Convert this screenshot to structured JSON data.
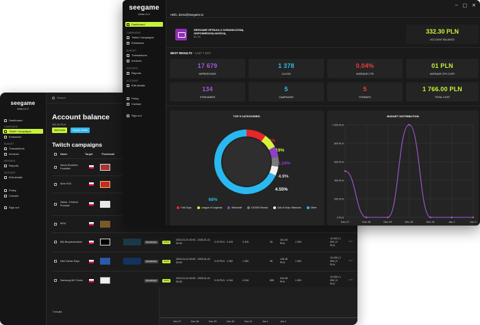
{
  "back": {
    "logo": "seegame",
    "version": "beta v1.0",
    "nav": {
      "sec_campaigns": "CAMPAIGNS",
      "sec_budget": "BUDGET",
      "sec_reports": "REPORTS",
      "sec_account": "ACCOUNT",
      "dashboard": "Dashboard",
      "twitch_campaigns": "Twitch Campaigns",
      "emissions": "Emissions",
      "transactions": "Transactions",
      "invoices": "Invoices",
      "reports": "Reports",
      "edit_details": "Edit details",
      "policy": "Policy",
      "contact": "Contact",
      "sign_out": "Sign out"
    },
    "search_placeholder": "Search",
    "account_balance_title": "Account balance",
    "account_amount": "332.30 PLN",
    "add_funds": "Add funds",
    "supply_charts": "Supply charts",
    "campaigns_title": "Twitch campaigns",
    "headers": {
      "name": "Name",
      "target": "Target",
      "thumbnail": "Thumbnail"
    },
    "rows": [
      {
        "name": "Savvy Monsters Footrallel"
      },
      {
        "name": "Alice KXD"
      },
      {
        "name": "Żabka - Festival Promote"
      },
      {
        "name": "IKEA",
        "type": "Gameboost",
        "status": "Active",
        "dates": "01 01 00:00",
        "rate": "0.10 PLN",
        "impr": "1 2 3",
        "clicks": "3.415",
        "cost": "745",
        "budget": "1 000"
      },
      {
        "name": "Blik Bezpiecznośnie",
        "type": "Gameboost",
        "status": "Active",
        "dates": "2024-01-01 00:00 - 2025-01-01 00:00",
        "rate": "0.10 PLN",
        "impr": "3 415",
        "clicks": "3 415",
        "ctr": "35",
        "cost": "341.50 PLN",
        "budget": "1 000",
        "total": "10 000 | 1 000 | 0 PLN"
      },
      {
        "name": "Intel Gamer Days",
        "type": "Gameboost",
        "status": "Active",
        "dates": "2024-01-01 00:00 - 2025-01-01 00:00",
        "rate": "0.10 PLN",
        "impr": "1 262",
        "clicks": "1 262",
        "ctr": "96",
        "cost": "126.26 PLN",
        "budget": "1 000",
        "total": "10 000 | 1 000 | 0 PLN"
      },
      {
        "name": "Samsung MX Fundu",
        "type": "Gameboost",
        "status": "Active",
        "dates": "2024-01-01 00:00 - 2025-01-01 00:00",
        "rate": "0.10 PLN",
        "impr": "4 244",
        "clicks": "4 244",
        "ctr": "895",
        "cost": "424.48 PLN",
        "budget": "1 000",
        "total": "10 000 | 1 000 | 0 PLN"
      }
    ],
    "results": "7 results",
    "mini_x": [
      "Dec 27",
      "Dec 28",
      "Dec 29",
      "Dec 30",
      "Dec 31",
      "Jan 1",
      "Jan 2"
    ]
  },
  "front": {
    "logo": "seegame",
    "version": "beta v1.0",
    "nav": {
      "dashboard": "Dashboard",
      "sec_campaigns": "CAMPAIGNS",
      "twitch_campaigns": "Twitch Campaigns",
      "emissions": "Emissions",
      "sec_budget": "BUDGET",
      "transactions": "Transactions",
      "invoices": "Invoices",
      "sec_reports": "REPORTS",
      "reports": "Reports",
      "sec_account": "ACCOUNT",
      "edit_details": "Edit details",
      "policy": "Policy",
      "contact": "Contact",
      "sign_out": "Sign out"
    },
    "hello": "Hello, demo@seegame.io",
    "company_name": "SEEGAME SPÓŁKA Z OGRANICZONĄ ODPOWIEDZIALNOŚCIĄ",
    "company_id": "ID: 23",
    "balance_value": "332.30 PLN",
    "balance_label": "ACCOUNT BALANCE",
    "best_results": "BEST RESULTS",
    "best_results_range": "LAST 7 DAY",
    "stats": [
      {
        "value": "17 679",
        "label": "IMPRESSIONS",
        "color": "#a259d9"
      },
      {
        "value": "1 378",
        "label": "CLICKS",
        "color": "#35b7ee"
      },
      {
        "value": "0.04%",
        "label": "AVERAGE CTR",
        "color": "#ee3b3b"
      },
      {
        "value": "01 PLN",
        "label": "AVERAGE CPV COST",
        "color": "#c7f23a"
      },
      {
        "value": "134",
        "label": "STREAMERS",
        "color": "#a259d9"
      },
      {
        "value": "5",
        "label": "CAMPAIGNS",
        "color": "#35b7ee"
      },
      {
        "value": "5",
        "label": "FORMATS",
        "color": "#ee3b3b"
      },
      {
        "value": "1 766.00 PLN",
        "label": "TOTAL COST",
        "color": "#c7f23a"
      }
    ],
    "donut_title": "TOP 5 CATEGORIES:",
    "budget_title": "BUDGET DISTRIBUTION"
  },
  "chart_data": [
    {
      "type": "pie",
      "title": "TOP 5 CATEGORIES:",
      "categories": [
        "Fall Guys",
        "League of Legends",
        "Minecraft",
        "DOOM Eternal",
        "Call of Duty: Warzone",
        "Other"
      ],
      "values": [
        10.02,
        7.19,
        5.34,
        4.9,
        4.55,
        68
      ],
      "labels": [
        "10.02%",
        "7.19%",
        "5.34%",
        "4.9%",
        "4.55%",
        "68%"
      ],
      "colors": [
        "#e8262b",
        "#d6f23a",
        "#8e3fc6",
        "#7a7a7a",
        "#f2f2f2",
        "#2ab8f0"
      ],
      "legend_position": "bottom"
    },
    {
      "type": "line",
      "title": "BUDGET DISTRIBUTION",
      "x": [
        "Dec 27",
        "Dec 28",
        "Dec 29",
        "Dec 30",
        "Dec 31",
        "Jan 1",
        "Jan 2"
      ],
      "y_ticks": [
        "1 000 PLN",
        "800 PLN",
        "600 PLN",
        "400 PLN",
        "200 PLN",
        "0 PLN"
      ],
      "series": [
        {
          "values": [
            500,
            0,
            0,
            1000,
            0,
            0,
            0
          ]
        }
      ],
      "ylim": [
        0,
        1000
      ],
      "grid": true,
      "color": "#a259d9"
    }
  ]
}
